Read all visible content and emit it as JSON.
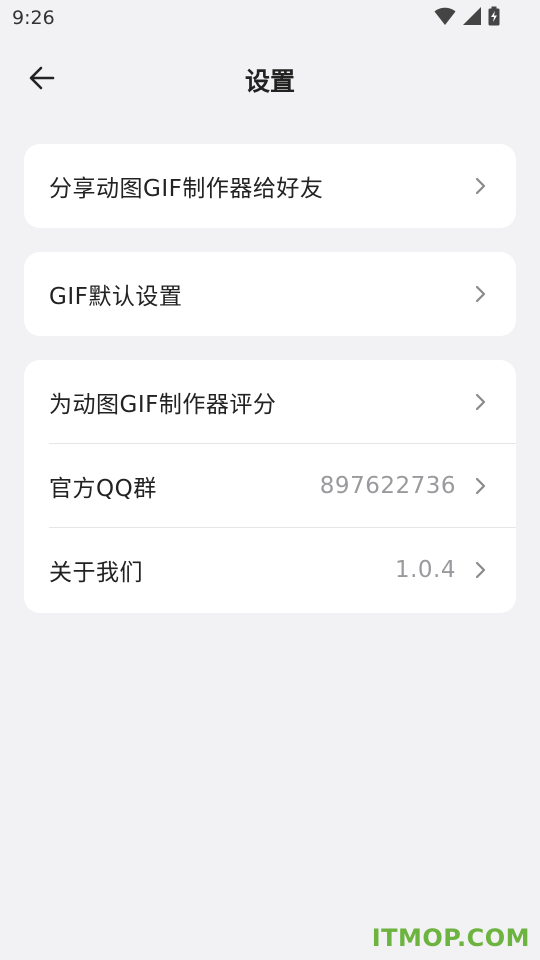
{
  "status": {
    "time": "9:26"
  },
  "header": {
    "title": "设置"
  },
  "cards": [
    {
      "items": [
        {
          "label": "分享动图GIF制作器给好友",
          "value": ""
        }
      ]
    },
    {
      "items": [
        {
          "label": "GIF默认设置",
          "value": ""
        }
      ]
    },
    {
      "items": [
        {
          "label": "为动图GIF制作器评分",
          "value": ""
        },
        {
          "label": "官方QQ群",
          "value": "897622736"
        },
        {
          "label": "关于我们",
          "value": "1.0.4"
        }
      ]
    }
  ],
  "watermark": "ITMOP.COM",
  "icons": {
    "back": "arrow-left-icon",
    "chevron": "chevron-right-icon",
    "wifi": "wifi-icon",
    "signal": "signal-icon",
    "battery": "battery-charging-icon"
  },
  "colors": {
    "background": "#f2f2f4",
    "card": "#ffffff",
    "secondary_text": "#9a9a9e",
    "watermark": "#6db33f"
  }
}
